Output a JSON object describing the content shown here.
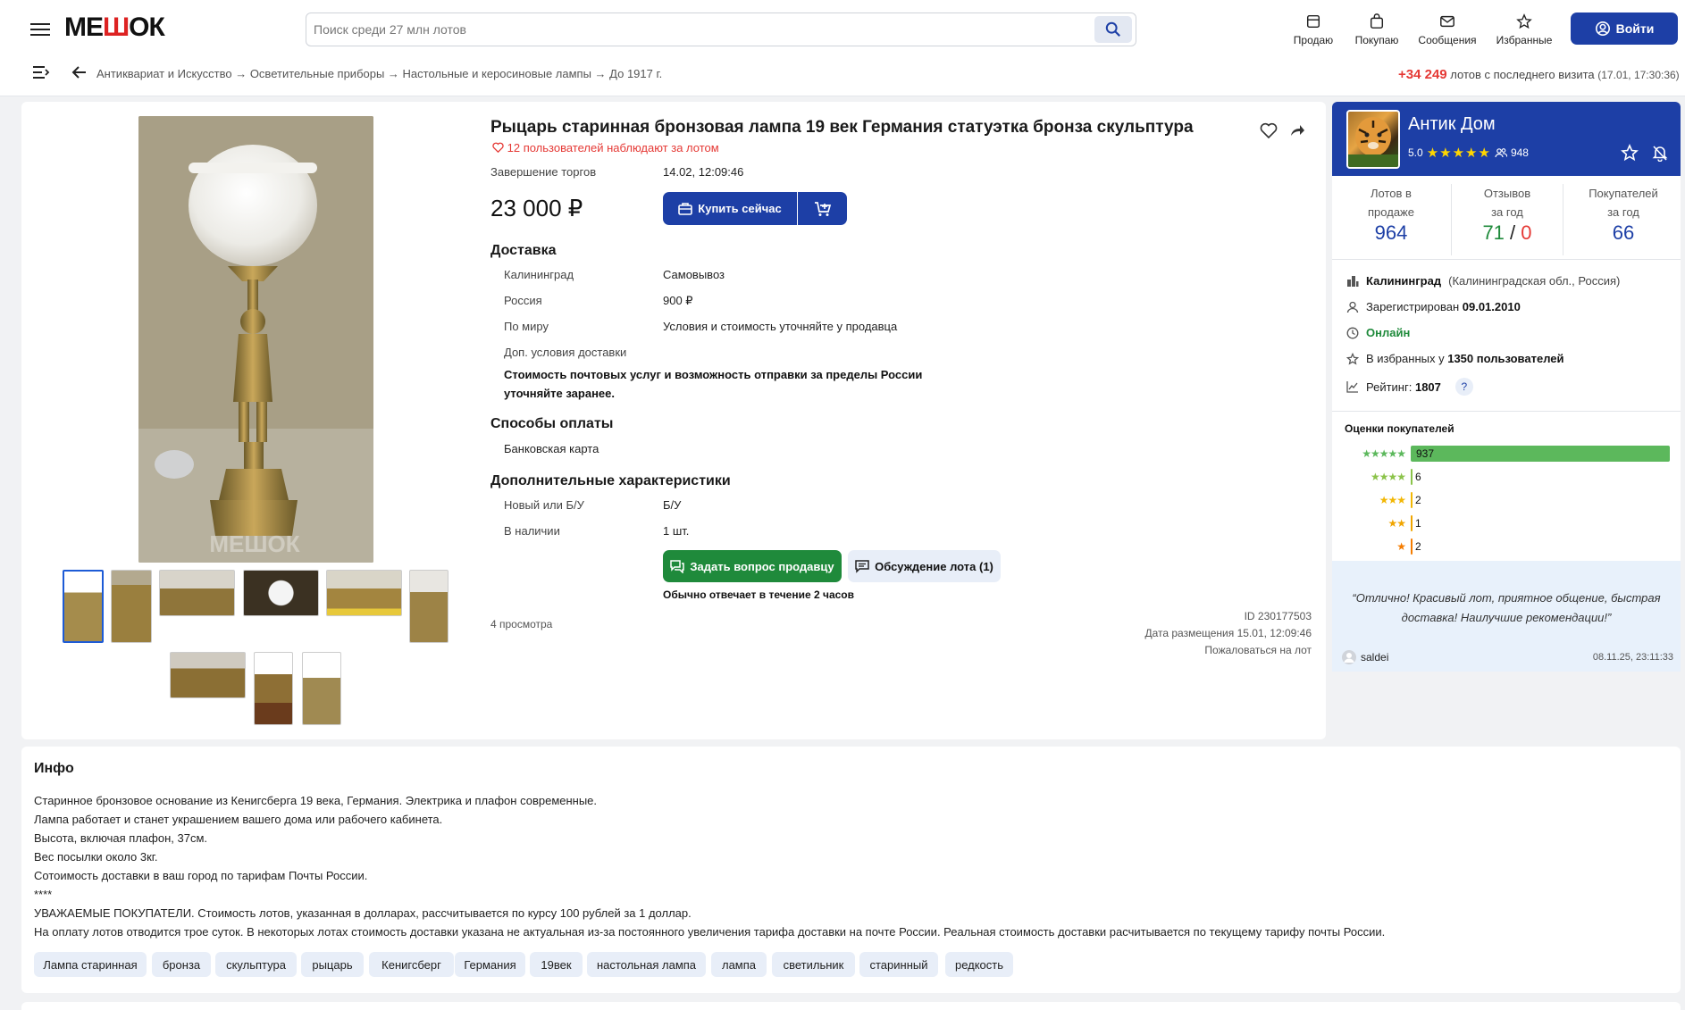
{
  "header": {
    "logo": "МЕШОК",
    "search_placeholder": "Поиск среди 27 млн лотов",
    "nav": [
      {
        "label": "Продаю",
        "icon": "store-icon"
      },
      {
        "label": "Покупаю",
        "icon": "bag-icon"
      },
      {
        "label": "Сообщения",
        "icon": "mail-icon"
      },
      {
        "label": "Избранные",
        "icon": "star-icon"
      }
    ],
    "login_label": "Войти",
    "breadcrumb": "Антиквариат и Искусство → Осветительные приборы → Настольные и керосиновые лампы → До 1917 г.",
    "new_lots_count": "+34 249",
    "new_lots_text": "лотов с последнего визита",
    "new_lots_time": "(17.01, 17:30:36)"
  },
  "lot": {
    "title": "Рыцарь старинная бронзовая лампа 19 век Германия статуэтка бронза скульптура",
    "watchers": "12 пользователей наблюдают за лотом",
    "end_label": "Завершение торгов",
    "end_value": "14.02, 12:09:46",
    "price": "23 000 ₽",
    "buy_label": "Купить сейчас",
    "delivery_title": "Доставка",
    "delivery": [
      {
        "label": "Калининград",
        "value": "Самовывоз"
      },
      {
        "label": "Россия",
        "value": "900 ₽"
      },
      {
        "label": "По миру",
        "value": "Условия и стоимость уточняйте у продавца"
      }
    ],
    "extra_delivery_label": "Доп. условия доставки",
    "extra_delivery_text_1": "Стоимость почтовых услуг и возможность отправки за пределы России",
    "extra_delivery_text_2": "уточняйте заранее.",
    "payment_title": "Способы оплаты",
    "payment_value": "Банковская карта",
    "chars_title": "Дополнительные характеристики",
    "chars": [
      {
        "label": "Новый или Б/У",
        "value": "Б/У"
      },
      {
        "label": "В наличии",
        "value": "1 шт."
      }
    ],
    "ask_label": "Задать вопрос продавцу",
    "discuss_label": "Обсуждение лота (1)",
    "reply_time": "Обычно отвечает в течение 2 часов",
    "views": "4 просмотра",
    "lot_id": "ID 230177503",
    "posted": "Дата размещения 15.01, 12:09:46",
    "report": "Пожаловаться на лот",
    "watermark": "МЕШОК"
  },
  "seller": {
    "name": "Антик Дом",
    "rating": "5.0",
    "stars": "★★★★★",
    "followers": "948",
    "stats": [
      {
        "label_1": "Лотов в",
        "label_2": "продаже",
        "value": "964"
      },
      {
        "label_1": "Отзывов",
        "label_2": "за год",
        "value_pos": "71",
        "value_sep": "/",
        "value_neg": "0"
      },
      {
        "label_1": "Покупателей",
        "label_2": "за год",
        "value": "66"
      }
    ],
    "city": "Калининград",
    "region": "(Калининградская обл., Россия)",
    "registered_label": "Зарегистрирован",
    "registered_date": "09.01.2010",
    "status": "Онлайн",
    "favorites_label": "В избранных у",
    "favorites_count": "1350 пользователей",
    "rating_label": "Рейтинг:",
    "rating_value": "1807",
    "help": "?",
    "ratings_title": "Оценки покупателей",
    "ratings": [
      {
        "stars": "★★★★★",
        "count": "937",
        "fraction": 1.0,
        "color": "#5cb85c"
      },
      {
        "stars": "★★★★",
        "count": "6",
        "fraction": 0.0064,
        "color": "#8bc34a"
      },
      {
        "stars": "★★★",
        "count": "2",
        "fraction": 0.0021,
        "color": "#f2b705"
      },
      {
        "stars": "★★",
        "count": "1",
        "fraction": 0.0011,
        "color": "#f0a500"
      },
      {
        "stars": "★",
        "count": "2",
        "fraction": 0.0021,
        "color": "#f57c00"
      }
    ],
    "review_text_1": "“Отлично! Красивый лот, приятное общение, быстрая",
    "review_text_2": "доставка! Наилучшие рекомендации!”",
    "review_user": "saldei",
    "review_date": "08.11.25, 23:11:33"
  },
  "info": {
    "title": "Инфо",
    "lines": [
      "Старинное бронзовое основание из Кенигсберга 19 века, Германия. Электрика и плафон современные.",
      "Лампа работает и станет украшением вашего дома или рабочего кабинета.",
      "Высота, включая плафон, 37см.",
      "Вес посылки около 3кг.",
      "Сотоимость доставки в ваш город по тарифам Почты России.",
      "****",
      "УВАЖАЕМЫЕ ПОКУПАТЕЛИ. Стоимость лотов, указанная в долларах, рассчитывается по курсу 100 рублей за 1 доллар.",
      "На оплату лотов отводится трое суток. В некоторых лотах стоимость доставки указана не актуальная из-за постоянного увеличения тарифа доставки на почте России. Реальная стоимость доставки расчитывается по текущему тарифу почты России."
    ],
    "tags": [
      "Лампа старинная",
      "бронза",
      "скульптура",
      "рыцарь",
      "Кенигсберг",
      "Германия",
      "19век",
      "настольная лампа",
      "лампа",
      "светильник",
      "старинный",
      "редкость"
    ]
  },
  "colors": {
    "primary": "#1d3fa6",
    "accent_red": "#e53935",
    "green": "#1f8a3b"
  }
}
